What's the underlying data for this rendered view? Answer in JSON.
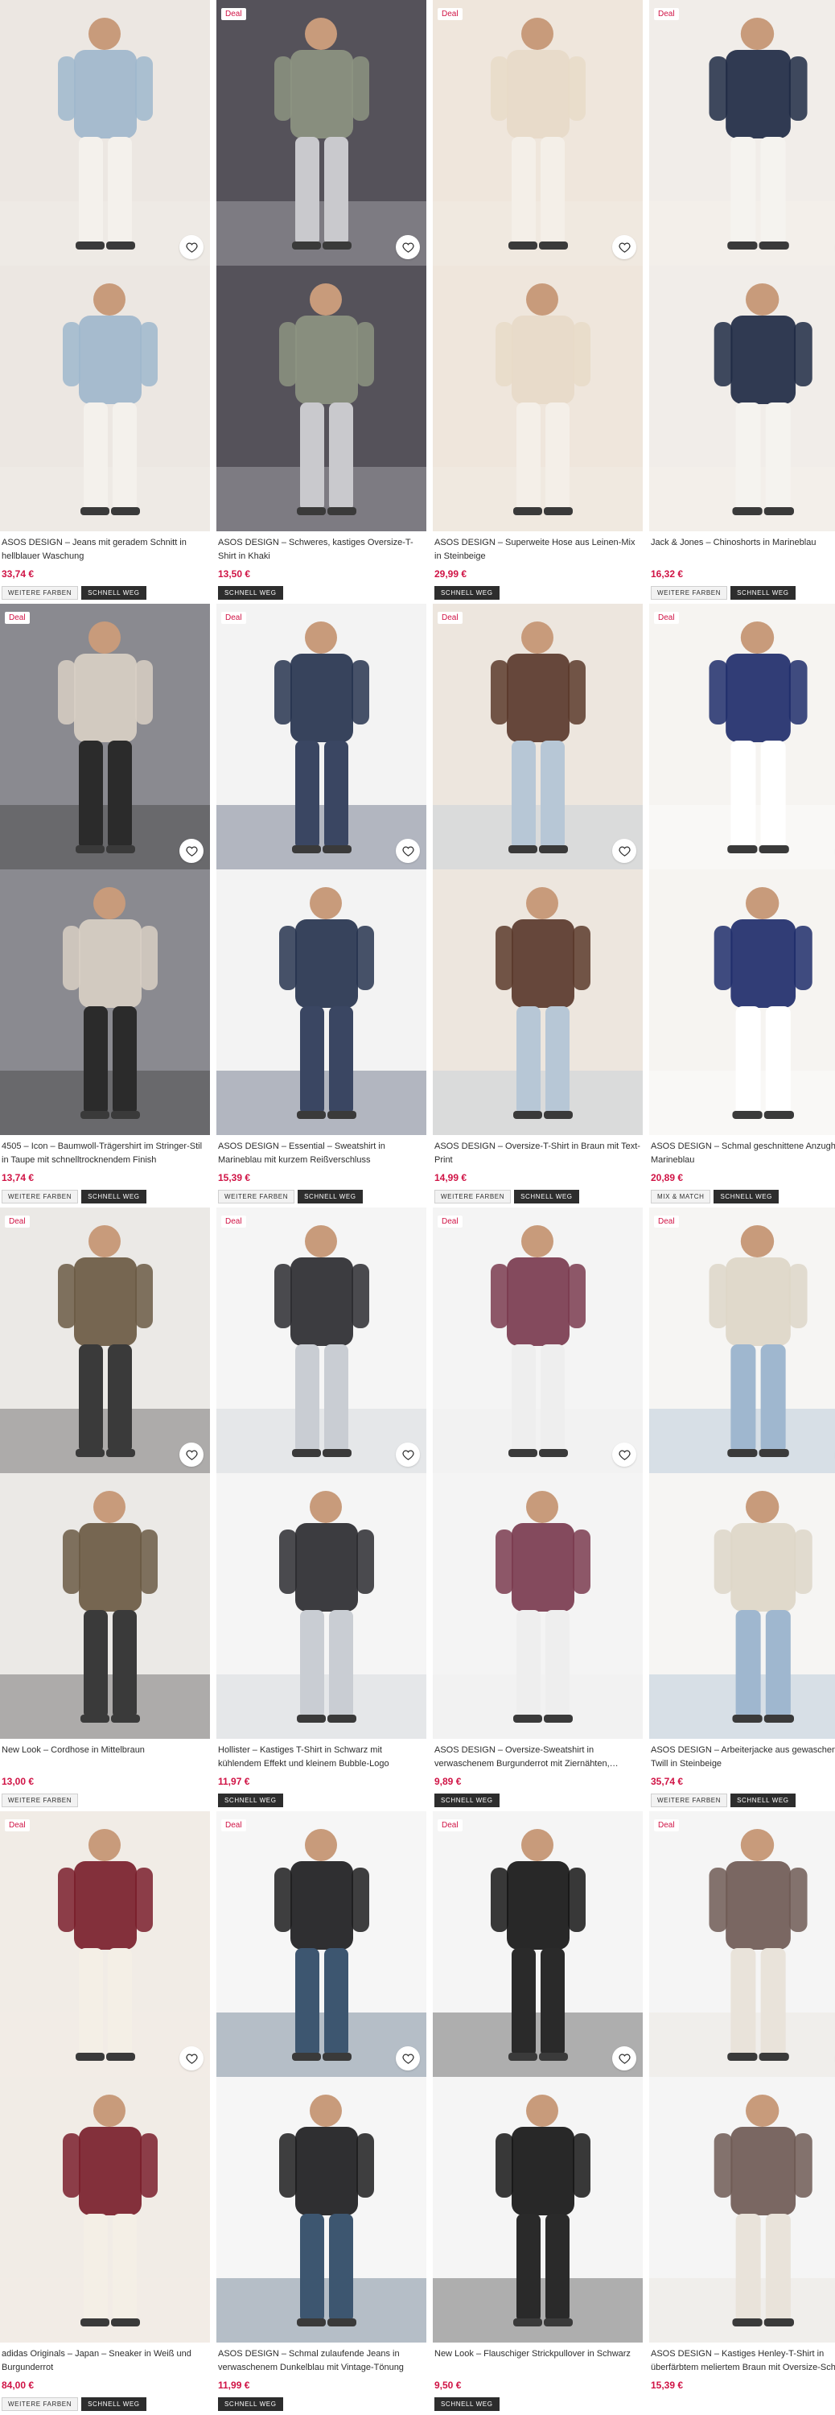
{
  "colors": {
    "accent": "#d01345",
    "badge_dark": "#2d2d2d"
  },
  "products": [
    {
      "deal": "",
      "title": "ASOS DESIGN – Jeans mit geradem Schnitt in hellblauer Waschung",
      "price": "33,74 €",
      "badges": [
        "WEITERE FARBEN",
        "SCHNELL WEG"
      ],
      "palette": [
        "#ece7e2",
        "#9fb7cc",
        "#f4f1ec"
      ]
    },
    {
      "deal": "Deal",
      "title": "ASOS DESIGN – Schweres, kastiges Oversize-T-Shirt in Khaki",
      "price": "13,50 €",
      "badges": [
        "SCHNELL WEG"
      ],
      "palette": [
        "#55525a",
        "#8d9481",
        "#c9c9cd"
      ]
    },
    {
      "deal": "Deal",
      "title": "ASOS DESIGN – Superweite Hose aus Leinen-Mix in Steinbeige",
      "price": "29,99 €",
      "badges": [
        "SCHNELL WEG"
      ],
      "palette": [
        "#efe6dc",
        "#e7dac8",
        "#f4efe8"
      ]
    },
    {
      "deal": "Deal",
      "title": "Jack & Jones – Chinoshorts in Marineblau",
      "price": "16,32 €",
      "badges": [
        "WEITERE FARBEN",
        "SCHNELL WEG"
      ],
      "palette": [
        "#f1ede9",
        "#1f2a44",
        "#f5f3ef"
      ]
    },
    {
      "deal": "Deal",
      "title": "4505 – Icon – Baumwoll-Trägershirt im Stringer-Stil in Taupe mit schnelltrocknendem Finish",
      "price": "13,74 €",
      "badges": [
        "WEITERE FARBEN",
        "SCHNELL WEG"
      ],
      "palette": [
        "#8a8a90",
        "#d8cfc4",
        "#2b2b2b"
      ]
    },
    {
      "deal": "Deal",
      "title": "ASOS DESIGN – Essential – Sweatshirt in Marineblau mit kurzem Reißverschluss",
      "price": "15,39 €",
      "badges": [
        "WEITERE FARBEN",
        "SCHNELL WEG"
      ],
      "palette": [
        "#f3f3f3",
        "#27344f",
        "#3a4662"
      ]
    },
    {
      "deal": "Deal",
      "title": "ASOS DESIGN – Oversize-T-Shirt in Braun mit Text-Print",
      "price": "14,99 €",
      "badges": [
        "WEITERE FARBEN",
        "SCHNELL WEG"
      ],
      "palette": [
        "#ede6de",
        "#5a3a2c",
        "#b7c7d6"
      ]
    },
    {
      "deal": "Deal",
      "title": "ASOS DESIGN – Schmal geschnittene Anzughose in Marineblau",
      "price": "20,89 €",
      "badges": [
        "MIX & MATCH",
        "SCHNELL WEG"
      ],
      "palette": [
        "#f6f4f1",
        "#1f2d6b",
        "#ffffff"
      ]
    },
    {
      "deal": "Deal",
      "title": "New Look – Cordhose in Mittelbraun",
      "price": "13,00 €",
      "badges": [
        "WEITERE FARBEN"
      ],
      "palette": [
        "#ebe9e6",
        "#6b5a44",
        "#3a3a3a"
      ]
    },
    {
      "deal": "Deal",
      "title": "Hollister – Kastiges T-Shirt in Schwarz mit kühlendem Effekt und kleinem Bubble-Logo",
      "price": "11,97 €",
      "badges": [
        "SCHNELL WEG"
      ],
      "palette": [
        "#f5f5f5",
        "#2b2b30",
        "#c9cdd3"
      ]
    },
    {
      "deal": "Deal",
      "title": "ASOS DESIGN – Oversize-Sweatshirt in verwaschenem Burgunderrot mit Ziernähten,…",
      "price": "9,89 €",
      "badges": [
        "SCHNELL WEG"
      ],
      "palette": [
        "#f4f4f4",
        "#7a3b4f",
        "#eeeeee"
      ]
    },
    {
      "deal": "Deal",
      "title": "ASOS DESIGN – Arbeiterjacke aus gewaschenem Twill in Steinbeige",
      "price": "35,74 €",
      "badges": [
        "WEITERE FARBEN",
        "SCHNELL WEG"
      ],
      "palette": [
        "#f6f5f3",
        "#ddd6c8",
        "#9fb7cf"
      ]
    },
    {
      "deal": "Deal",
      "title": "adidas Originals – Japan – Sneaker in Weiß und Burgunderrot",
      "price": "84,00 €",
      "badges": [
        "WEITERE FARBEN",
        "SCHNELL WEG"
      ],
      "palette": [
        "#f1ece6",
        "#7a1f2c",
        "#f4efe6"
      ]
    },
    {
      "deal": "Deal",
      "title": "ASOS DESIGN – Schmal zulaufende Jeans in verwaschenem Dunkelblau mit Vintage-Tönung",
      "price": "11,99 €",
      "badges": [
        "SCHNELL WEG"
      ],
      "palette": [
        "#f6f6f6",
        "#1d1d1f",
        "#3d5670"
      ]
    },
    {
      "deal": "Deal",
      "title": "New Look – Flauschiger Strickpullover in Schwarz",
      "price": "9,50 €",
      "badges": [
        "SCHNELL WEG"
      ],
      "palette": [
        "#f5f5f5",
        "#161616",
        "#2a2a2a"
      ]
    },
    {
      "deal": "Deal",
      "title": "ASOS DESIGN – Kastiges Henley-T-Shirt in überfärbtem meliertem Braun mit Oversize-Schnitt",
      "price": "15,39 €",
      "badges": [],
      "palette": [
        "#f5f5f5",
        "#6f5a55",
        "#e9e3da"
      ]
    }
  ]
}
